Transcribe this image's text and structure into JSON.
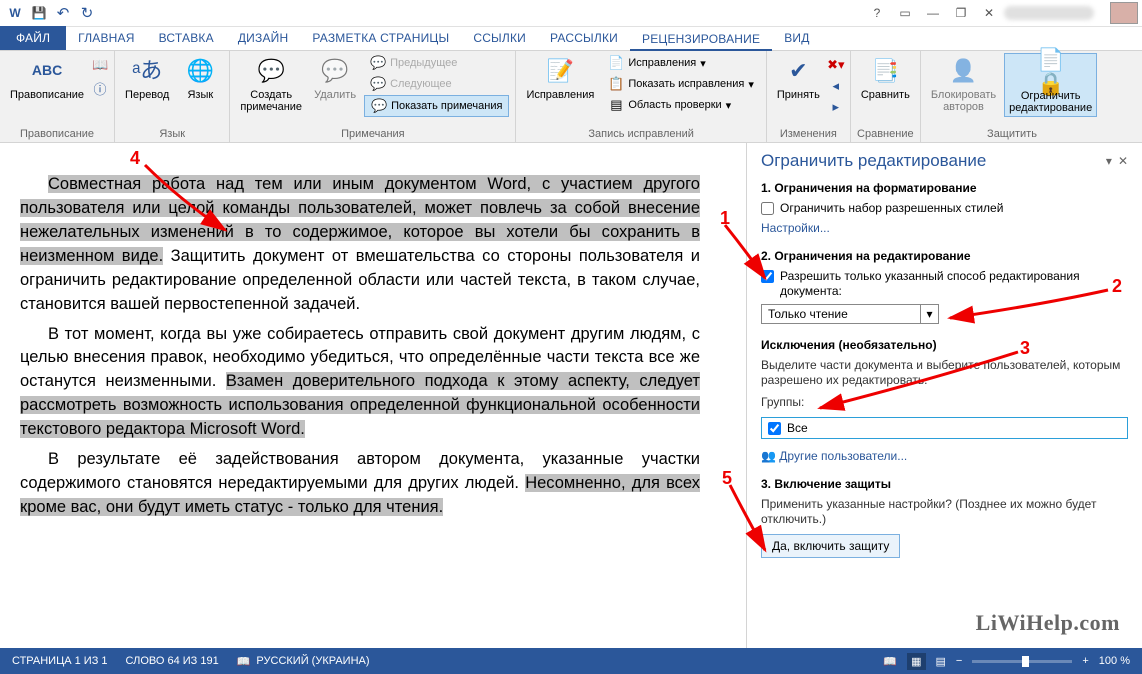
{
  "qat": {
    "word": "W",
    "save": "💾",
    "undo": "↶",
    "redo": "↻"
  },
  "titlectrl": {
    "help": "?",
    "ribbonopts": "▭",
    "min": "—",
    "restore": "❐",
    "close": "✕"
  },
  "tabs": {
    "file": "ФАЙЛ",
    "home": "ГЛАВНАЯ",
    "insert": "ВСТАВКА",
    "design": "ДИЗАЙН",
    "layout": "РАЗМЕТКА СТРАНИЦЫ",
    "refs": "ССЫЛКИ",
    "mail": "РАССЫЛКИ",
    "review": "РЕЦЕНЗИРОВАНИЕ",
    "view": "ВИД"
  },
  "ribbon": {
    "spelling": {
      "btn": "Правописание",
      "label": "Правописание",
      "icon": "ABC"
    },
    "language": {
      "translate": "Перевод",
      "lang": "Язык",
      "label": "Язык"
    },
    "comments": {
      "new": "Создать\nпримечание",
      "delete": "Удалить",
      "prev": "Предыдущее",
      "next": "Следующее",
      "show": "Показать примечания",
      "label": "Примечания"
    },
    "tracking": {
      "btn": "Исправления",
      "combo": "Исправления",
      "showmarkup": "Показать исправления",
      "pane": "Область проверки",
      "label": "Запись исправлений"
    },
    "changes": {
      "accept": "Принять",
      "label": "Изменения"
    },
    "compare": {
      "btn": "Сравнить",
      "label": "Сравнение"
    },
    "protect": {
      "block": "Блокировать\nавторов",
      "restrict": "Ограничить\nредактирование",
      "label": "Защитить"
    }
  },
  "doc": {
    "p1a": "Совместная работа над тем или иным документом Word, с участием другого пользователя или целой команды пользователей, может повлечь за собой внесение нежелательных изменений в то содержимое, которое вы хотели бы сохранить в неизменном виде.",
    "p1b": " Защитить документ от вмешательства со стороны пользователя и ограничить редактирование определенной области или частей текста, в таком случае, становится вашей первостепенной задачей.",
    "p2a": "В тот момент, когда вы уже собираетесь отправить свой документ другим людям, с целью внесения правок, необходимо убедиться, что определённые части текста все же останутся неизменными. ",
    "p2b": "Взамен доверительного подхода к этому аспекту, следует рассмотреть возможность использования определенной функциональной особенности текстового редактора Microsoft Word.",
    "p3a": "В результате её задействования автором документа, указанные участки содержимого становятся нередактируемыми для других людей. ",
    "p3b": "Несомненно, для всех кроме вас, они будут иметь статус - только для чтения."
  },
  "pane": {
    "title": "Ограничить редактирование",
    "s1": {
      "h": "1. Ограничения на форматирование",
      "chk": "Ограничить набор разрешенных стилей",
      "link": "Настройки..."
    },
    "s2": {
      "h": "2. Ограничения на редактирование",
      "chk": "Разрешить только указанный способ редактирования документа:",
      "combo": "Только чтение"
    },
    "ex": {
      "h": "Исключения (необязательно)",
      "txt": "Выделите части документа и выберите пользователей, которым разрешено их редактировать.",
      "grp": "Группы:",
      "all": "Все",
      "more": "Другие пользователи..."
    },
    "s3": {
      "h": "3. Включение защиты",
      "txt": "Применить указанные настройки? (Позднее их можно будет отключить.)",
      "btn": "Да, включить защиту"
    }
  },
  "status": {
    "page": "СТРАНИЦА 1 ИЗ 1",
    "words": "СЛОВО 64 ИЗ 191",
    "lang": "РУССКИЙ (УКРАИНА)",
    "zoom": "100 %"
  },
  "annotations": {
    "1": "1",
    "2": "2",
    "3": "3",
    "4": "4",
    "5": "5"
  },
  "watermark": "LiWiHelp.com"
}
